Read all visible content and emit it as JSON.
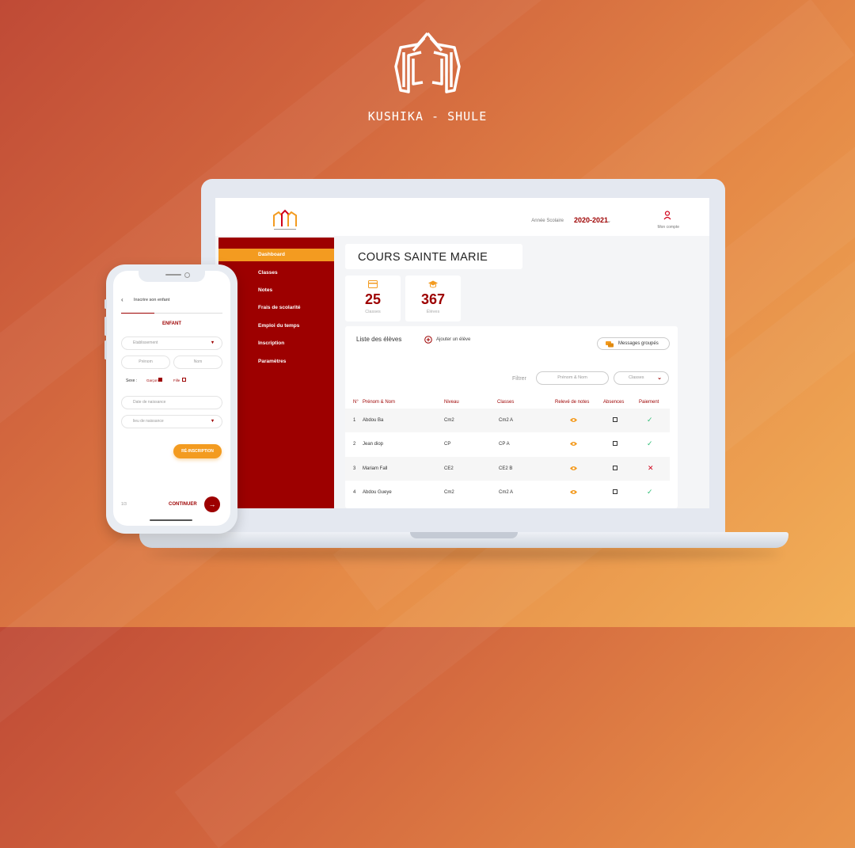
{
  "brand": {
    "name": "KUSHIKA - SHULE"
  },
  "topbar": {
    "year_label": "Année Scolaire",
    "year_value": "2020-2021",
    "account_label": "Mon compte"
  },
  "sidebar": {
    "items": [
      {
        "label": "Dashboard",
        "active": true
      },
      {
        "label": "Classes"
      },
      {
        "label": "Notes"
      },
      {
        "label": "Frais de scolarité"
      },
      {
        "label": "Emploi du temps"
      },
      {
        "label": "Inscription"
      },
      {
        "label": "Paramètres"
      }
    ]
  },
  "main": {
    "school_name": "COURS SAINTE MARIE",
    "stats": [
      {
        "value": "25",
        "label": "Classes",
        "icon": "card-icon"
      },
      {
        "value": "367",
        "label": "Élèves",
        "icon": "graduation-cap-icon"
      }
    ],
    "list_title": "Liste des élèves",
    "add_student_label": "Ajouter un élève",
    "group_messages_label": "Messages groupés",
    "filter_label": "Filtrer",
    "filter_placeholder": "Prénom & Nom",
    "class_select": "Classes",
    "table": {
      "headers": [
        "N°",
        "Prénom & Nom",
        "Niveau",
        "Classes",
        "Relevé de notes",
        "Absences",
        "Paiement"
      ],
      "rows": [
        {
          "num": "1",
          "name": "Abdou Ba",
          "level": "Cm2",
          "class": "Cm2 A",
          "paid": true
        },
        {
          "num": "2",
          "name": "Jean diop",
          "level": "CP",
          "class": "CP A",
          "paid": true
        },
        {
          "num": "3",
          "name": "Mariam Fall",
          "level": "CE2",
          "class": "CE2 B",
          "paid": false
        },
        {
          "num": "4",
          "name": "Abdou Gueye",
          "level": "Cm2",
          "class": "Cm2 A",
          "paid": true
        }
      ]
    }
  },
  "phone": {
    "title": "Inscrire son enfant",
    "progress": 0.33,
    "section": "ENFANT",
    "fields": {
      "establishment": "Etablissement",
      "firstname": "Prénom",
      "lastname": "Nom",
      "birthdate": "Date de naissance",
      "birthplace": "lieu de naissance"
    },
    "sexe_label": "Sexe :",
    "garcon_label": "Garçon",
    "fille_label": "Fille",
    "reinscription_label": "RÉ-INSCRIPTION",
    "page": "1/3",
    "continue_label": "CONTINUER"
  },
  "colors": {
    "primary": "#9d0000",
    "accent": "#f39b20",
    "success": "#2ebd75",
    "danger": "#d0021b"
  }
}
